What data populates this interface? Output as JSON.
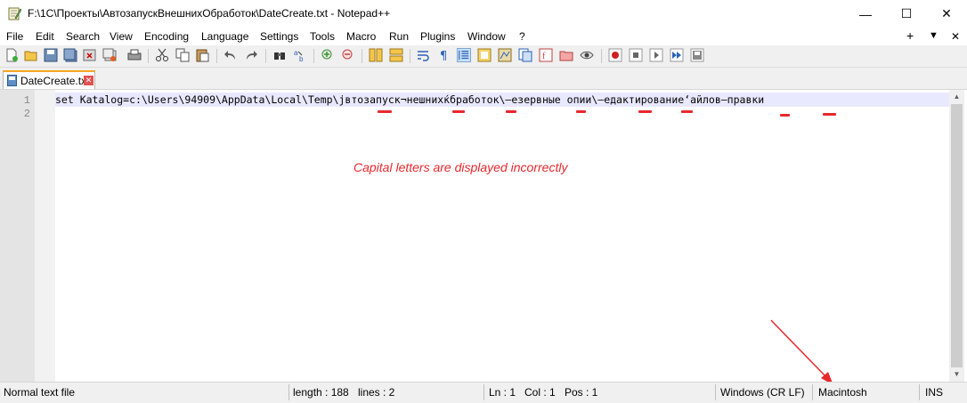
{
  "window": {
    "title": "F:\\1C\\Проекты\\АвтозапускВнешнихОбработок\\DateCreate.txt - Notepad++",
    "minimize": "—",
    "maximize": "☐",
    "close": "✕"
  },
  "menu": {
    "items": [
      "File",
      "Edit",
      "Search",
      "View",
      "Encoding",
      "Language",
      "Settings",
      "Tools",
      "Macro",
      "Run",
      "Plugins",
      "Window",
      "?"
    ],
    "right_plus": "+",
    "right_down": "▼",
    "right_close": "✕"
  },
  "tab": {
    "label": "DateCreate.txt",
    "close": "✕"
  },
  "editor": {
    "line_numbers": [
      "1",
      "2"
    ],
    "lines": [
      "set Katalog=c:\\Users\\94909\\AppData\\Local\\Temp\\јвтозапуск¬нешнихќбработок\\–езервные опии\\–едактирование‘айлов–правки",
      ""
    ],
    "annotation": "Capital letters are displayed incorrectly",
    "annotation_color": "#e8282d"
  },
  "statusbar": {
    "file_type": "Normal text file",
    "length": "length : 188",
    "lines": "lines : 2",
    "ln": "Ln : 1",
    "col": "Col : 1",
    "pos": "Pos : 1",
    "eol": "Windows (CR LF)",
    "encoding": "Macintosh",
    "mode": "INS"
  }
}
